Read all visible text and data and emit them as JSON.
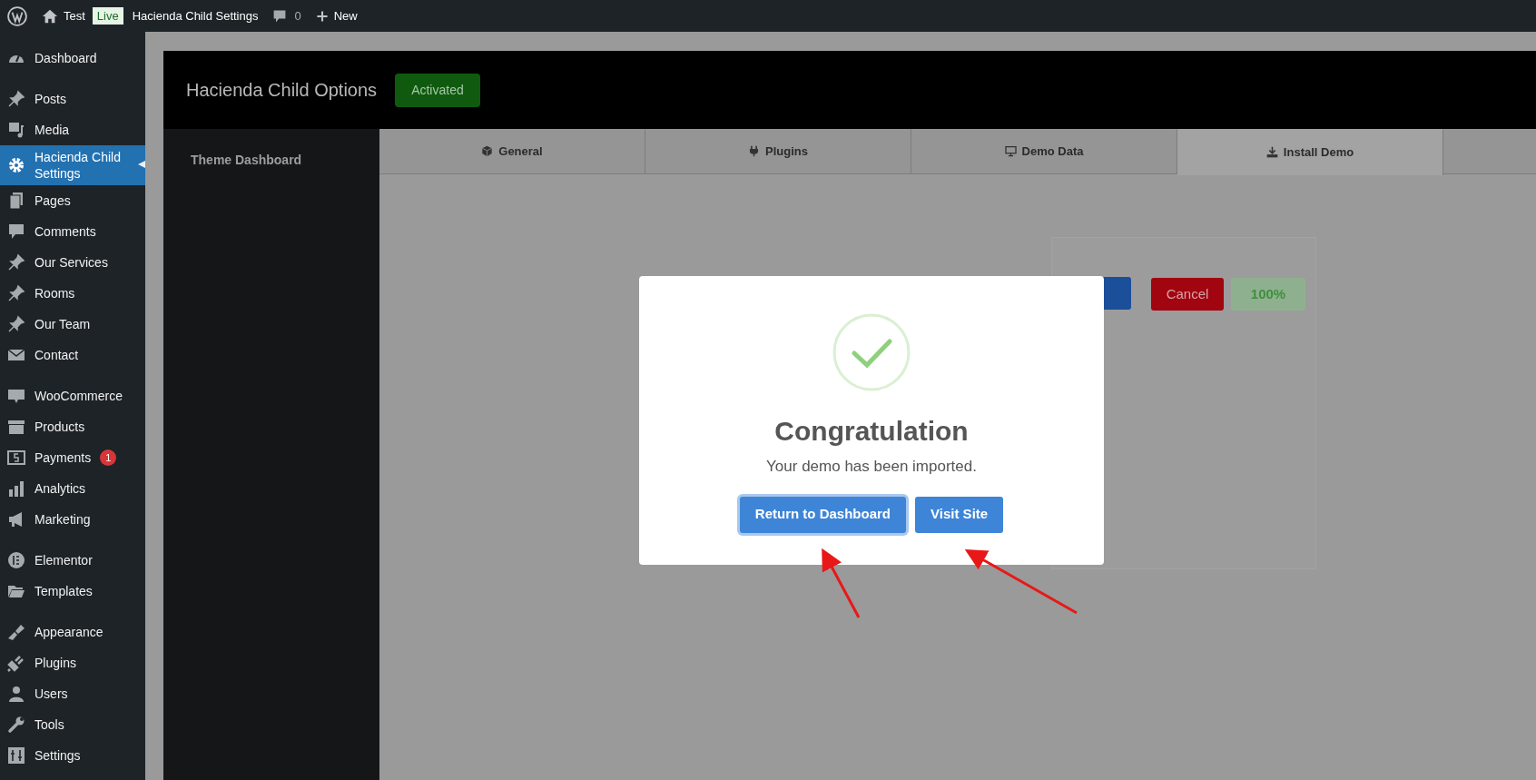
{
  "admin_bar": {
    "site": "Test",
    "live_badge": "Live",
    "page": "Hacienda Child Settings",
    "comments": "0",
    "new": "New"
  },
  "sidebar": {
    "groups": [
      [
        {
          "label": "Dashboard",
          "selected": false
        }
      ],
      [
        {
          "label": "Posts",
          "selected": false
        },
        {
          "label": "Media",
          "selected": false
        },
        {
          "label": "Hacienda Child Settings",
          "selected": true
        },
        {
          "label": "Pages",
          "selected": false
        },
        {
          "label": "Comments",
          "selected": false
        },
        {
          "label": "Our Services",
          "selected": false
        },
        {
          "label": "Rooms",
          "selected": false
        },
        {
          "label": "Our Team",
          "selected": false
        },
        {
          "label": "Contact",
          "selected": false
        }
      ],
      [
        {
          "label": "WooCommerce",
          "selected": false
        },
        {
          "label": "Products",
          "selected": false
        },
        {
          "label": "Payments",
          "selected": false,
          "badge": "1"
        },
        {
          "label": "Analytics",
          "selected": false
        },
        {
          "label": "Marketing",
          "selected": false
        }
      ],
      [
        {
          "label": "Elementor",
          "selected": false
        },
        {
          "label": "Templates",
          "selected": false
        }
      ],
      [
        {
          "label": "Appearance",
          "selected": false
        },
        {
          "label": "Plugins",
          "selected": false
        },
        {
          "label": "Users",
          "selected": false
        },
        {
          "label": "Tools",
          "selected": false
        },
        {
          "label": "Settings",
          "selected": false
        }
      ]
    ]
  },
  "panel": {
    "title": "Hacienda Child Options",
    "status": "Activated",
    "side_item": "Theme Dashboard",
    "tabs": [
      {
        "label": "General",
        "selected": false
      },
      {
        "label": "Plugins",
        "selected": false
      },
      {
        "label": "Demo Data",
        "selected": false
      },
      {
        "label": "Install Demo",
        "selected": true
      }
    ],
    "cancel": "Cancel",
    "progress": "100%"
  },
  "modal": {
    "title": "Congratulation",
    "message": "Your demo has been imported.",
    "buttons": [
      {
        "label": "Return to Dashboard",
        "focused": true
      },
      {
        "label": "Visit Site",
        "focused": false
      }
    ]
  }
}
